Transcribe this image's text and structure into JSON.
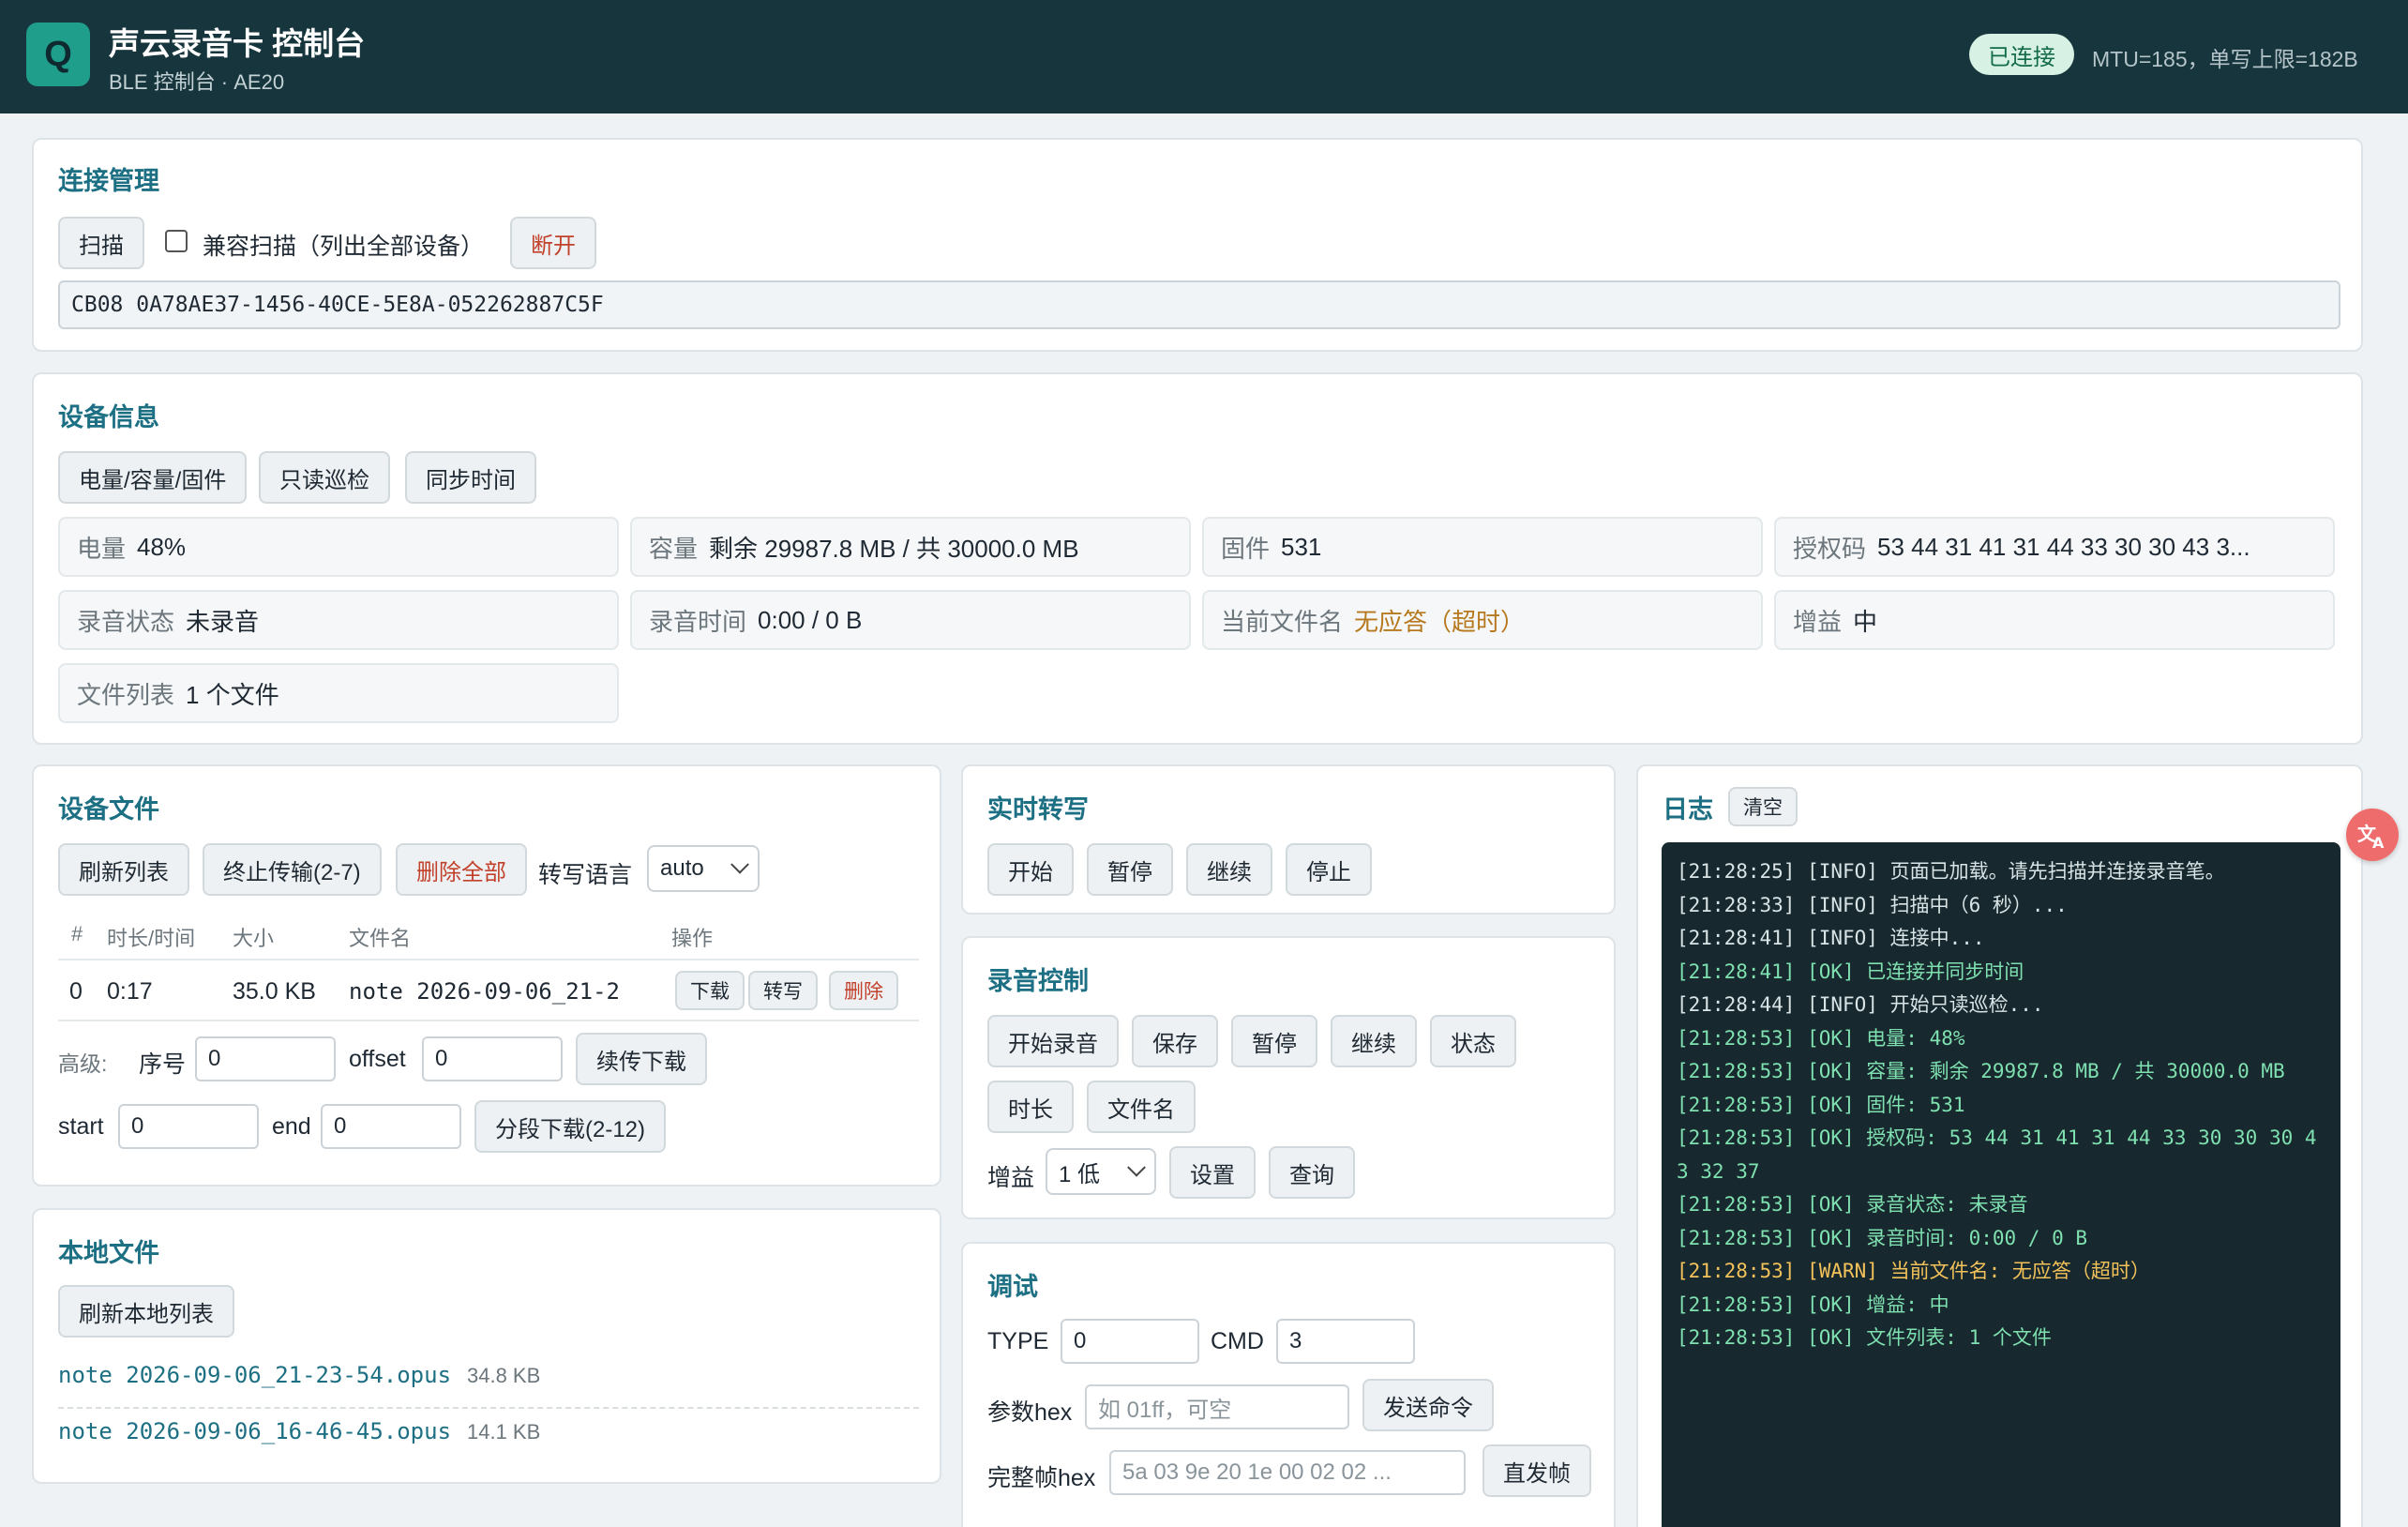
{
  "header": {
    "logo_letter": "Q",
    "title": "声云录音卡 控制台",
    "subtitle": "BLE 控制台 · AE20",
    "status": "已连接",
    "mtu": "MTU=185，单写上限=182B"
  },
  "connection": {
    "title": "连接管理",
    "scan_label": "扫描",
    "compat_label": "兼容扫描（列出全部设备）",
    "disconnect_label": "断开",
    "device_id": "CB08 0A78AE37-1456-40CE-5E8A-052262887C5F"
  },
  "device_info": {
    "title": "设备信息",
    "buttons": [
      "电量/容量/固件",
      "只读巡检",
      "同步时间"
    ],
    "fields": [
      {
        "label": "电量",
        "value": "48%"
      },
      {
        "label": "容量",
        "value": "剩余 29987.8 MB / 共 30000.0 MB"
      },
      {
        "label": "固件",
        "value": "531"
      },
      {
        "label": "授权码",
        "value": "53 44 31 41 31 44 33 30 30 43 3..."
      },
      {
        "label": "录音状态",
        "value": "未录音"
      },
      {
        "label": "录音时间",
        "value": "0:00 / 0 B"
      },
      {
        "label": "当前文件名",
        "value": "无应答（超时）"
      },
      {
        "label": "增益",
        "value": "中"
      },
      {
        "label": "文件列表",
        "value": "1 个文件"
      }
    ]
  },
  "device_files": {
    "title": "设备文件",
    "refresh_label": "刷新列表",
    "abort_label": "终止传输(2-7)",
    "delete_all_label": "删除全部",
    "lang_label": "转写语言",
    "lang_value": "auto",
    "columns": [
      "#",
      "时长/时间",
      "大小",
      "文件名",
      "操作"
    ],
    "rows": [
      {
        "index": "0",
        "duration": "0:17",
        "size": "35.0 KB",
        "name": "note 2026-09-06_21-2",
        "download": "下载",
        "transcribe": "转写",
        "delete": "删除"
      }
    ],
    "advanced_label": "高级:",
    "seq_label": "序号",
    "seq_value": "0",
    "offset_label": "offset",
    "offset_value": "0",
    "resume_label": "续传下载",
    "start_label": "start",
    "start_value": "0",
    "end_label": "end",
    "end_value": "0",
    "segment_label": "分段下载(2-12)"
  },
  "local_files": {
    "title": "本地文件",
    "refresh_label": "刷新本地列表",
    "files": [
      {
        "name": "note 2026-09-06_21-23-54.opus",
        "size": "34.8 KB"
      },
      {
        "name": "note 2026-09-06_16-46-45.opus",
        "size": "14.1 KB"
      }
    ]
  },
  "realtime": {
    "title": "实时转写",
    "buttons": [
      "开始",
      "暂停",
      "继续",
      "停止"
    ]
  },
  "recording": {
    "title": "录音控制",
    "buttons_row1": [
      "开始录音",
      "保存",
      "暂停",
      "继续",
      "状态"
    ],
    "buttons_row2": [
      "时长",
      "文件名"
    ],
    "gain_label": "增益",
    "gain_value": "1 低",
    "set_label": "设置",
    "query_label": "查询"
  },
  "debug": {
    "title": "调试",
    "type_label": "TYPE",
    "type_value": "0",
    "cmd_label": "CMD",
    "cmd_value": "3",
    "param_label": "参数hex",
    "param_placeholder": "如 01ff，可空",
    "send_label": "发送命令",
    "frame_label": "完整帧hex",
    "frame_placeholder": "5a 03 9e 20 1e 00 02 02 ...",
    "direct_label": "直发帧"
  },
  "log": {
    "title": "日志",
    "clear_label": "清空",
    "lines": [
      {
        "level": "info",
        "text": "[21:28:25] [INFO] 页面已加载。请先扫描并连接录音笔。"
      },
      {
        "level": "info",
        "text": "[21:28:33] [INFO] 扫描中（6 秒）..."
      },
      {
        "level": "info",
        "text": "[21:28:41] [INFO] 连接中..."
      },
      {
        "level": "ok",
        "text": "[21:28:41] [OK] 已连接并同步时间"
      },
      {
        "level": "info",
        "text": "[21:28:44] [INFO] 开始只读巡检..."
      },
      {
        "level": "ok",
        "text": "[21:28:53] [OK] 电量: 48%"
      },
      {
        "level": "ok",
        "text": "[21:28:53] [OK] 容量: 剩余 29987.8 MB / 共 30000.0 MB"
      },
      {
        "level": "ok",
        "text": "[21:28:53] [OK] 固件: 531"
      },
      {
        "level": "ok",
        "text": "[21:28:53] [OK] 授权码: 53 44 31 41 31 44 33 30 30 30 43 32 37"
      },
      {
        "level": "ok",
        "text": "[21:28:53] [OK] 录音状态: 未录音"
      },
      {
        "level": "ok",
        "text": "[21:28:53] [OK] 录音时间: 0:00 / 0 B"
      },
      {
        "level": "warn",
        "text": "[21:28:53] [WARN] 当前文件名: 无应答（超时）"
      },
      {
        "level": "ok",
        "text": "[21:28:53] [OK] 增益: 中"
      },
      {
        "level": "ok",
        "text": "[21:28:53] [OK] 文件列表: 1 个文件"
      }
    ]
  },
  "translate_icon": "translate-icon",
  "colors": {
    "header_bg": "#17353d",
    "accent": "#1d6f83",
    "ok": "#7fe0b0",
    "warn": "#f3c25a"
  }
}
